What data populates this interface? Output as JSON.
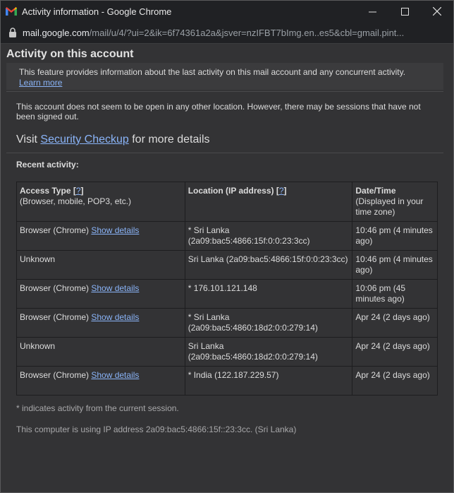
{
  "window": {
    "title": "Activity information - Google Chrome",
    "url_host": "mail.google.com",
    "url_path": "/mail/u/4/?ui=2&ik=6f74361a2a&jsver=nzIFBT7bImg.en..es5&cbl=gmail.pint..."
  },
  "page": {
    "heading": "Activity on this account",
    "info_text": "This feature provides information about the last activity on this mail account and any concurrent activity.",
    "learn_more": "Learn more",
    "notice": "This account does not seem to be open in any other location. However, there may be sessions that have not been signed out.",
    "visit_prefix": "Visit",
    "security_checkup": "Security Checkup",
    "visit_suffix": "for more details",
    "recent_label": "Recent activity:",
    "footnote_current": "* indicates activity from the current session.",
    "footnote_ip": "This computer is using IP address 2a09:bac5:4866:15f::23:3cc. (Sri Lanka)"
  },
  "table": {
    "headers": [
      {
        "title": "Access Type",
        "bracket_open": "[",
        "help": "?",
        "bracket_close": "]",
        "sub": "(Browser, mobile, POP3, etc.)"
      },
      {
        "title": "Location (IP address)",
        "bracket_open": "[",
        "help": "?",
        "bracket_close": "]",
        "sub": ""
      },
      {
        "title": "Date/Time",
        "sub": "(Displayed in your time zone)"
      }
    ],
    "rows": [
      {
        "access": "Browser (Chrome)",
        "details": "Show details",
        "location": "* Sri Lanka (2a09:bac5:4866:15f:0:0:23:3cc)",
        "time": "10:46 pm (4 minutes ago)"
      },
      {
        "access": "Unknown",
        "details": "",
        "location": "Sri Lanka (2a09:bac5:4866:15f:0:0:23:3cc)",
        "time": "10:46 pm (4 minutes ago)"
      },
      {
        "access": "Browser (Chrome)",
        "details": "Show details",
        "location": "* 176.101.121.148",
        "time": "10:06 pm (45 minutes ago)"
      },
      {
        "access": "Browser (Chrome)",
        "details": "Show details",
        "location": "* Sri Lanka (2a09:bac5:4860:18d2:0:0:279:14)",
        "time": "Apr 24 (2 days ago)"
      },
      {
        "access": "Unknown",
        "details": "",
        "location": "Sri Lanka (2a09:bac5:4860:18d2:0:0:279:14)",
        "time": "Apr 24 (2 days ago)"
      },
      {
        "access": "Browser (Chrome)",
        "details": "Show details",
        "location": "* India (122.187.229.57)",
        "time": "Apr 24 (2 days ago)"
      }
    ]
  }
}
